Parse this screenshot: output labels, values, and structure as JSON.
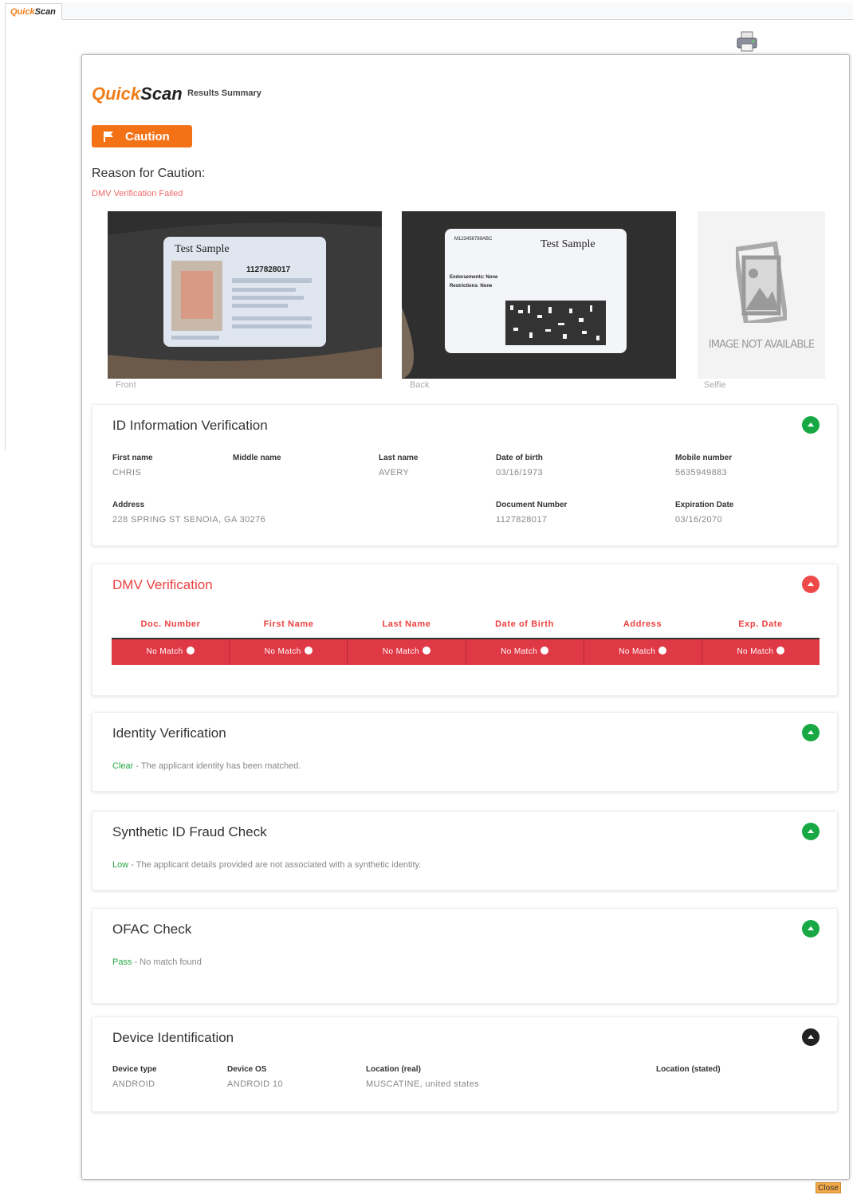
{
  "tab": {
    "brand_quick": "Quick",
    "brand_scan": "Scan"
  },
  "header": {
    "brand_quick": "Quick",
    "brand_scan": "Scan",
    "subtitle": "Results Summary"
  },
  "status": {
    "label": "Caution",
    "color": "#f47216"
  },
  "reason": {
    "title": "Reason for Caution:",
    "text": "DMV Verification Failed"
  },
  "images": {
    "front": {
      "caption": "Front",
      "card_title": "Test Sample",
      "dln": "1127828017"
    },
    "back": {
      "caption": "Back",
      "card_title": "Test Sample",
      "code": "M123456789ABC",
      "endorsements": "Endorsements: None",
      "restrictions": "Restrictions: None"
    },
    "selfie": {
      "caption": "Selfie",
      "placeholder": "IMAGE NOT AVAILABLE"
    }
  },
  "id_verification": {
    "title": "ID Information Verification",
    "fields": {
      "first_name": {
        "label": "First name",
        "value": "CHRIS"
      },
      "middle_name": {
        "label": "Middle name",
        "value": ""
      },
      "last_name": {
        "label": "Last name",
        "value": "AVERY"
      },
      "dob": {
        "label": "Date of birth",
        "value": "03/16/1973"
      },
      "mobile": {
        "label": "Mobile number",
        "value": "5635949883"
      },
      "address": {
        "label": "Address",
        "value": "228 SPRING ST SENOIA, GA 30276"
      },
      "doc_number": {
        "label": "Document Number",
        "value": "1127828017"
      },
      "expiration": {
        "label": "Expiration Date",
        "value": "03/16/2070"
      }
    }
  },
  "dmv": {
    "title": "DMV Verification",
    "headers": [
      "Doc. Number",
      "First Name",
      "Last Name",
      "Date of Birth",
      "Address",
      "Exp. Date"
    ],
    "results": [
      "No Match",
      "No Match",
      "No Match",
      "No Match",
      "No Match",
      "No Match"
    ]
  },
  "identity": {
    "title": "Identity Verification",
    "status": "Clear",
    "text": " - The applicant identity has been matched."
  },
  "synthetic": {
    "title": "Synthetic ID Fraud Check",
    "status": "Low",
    "text": " - The applicant details provided are not associated with a synthetic identity."
  },
  "ofac": {
    "title": "OFAC Check",
    "status": "Pass",
    "text": " - No match found"
  },
  "device": {
    "title": "Device Identification",
    "fields": {
      "type": {
        "label": "Device type",
        "value": "ANDROID"
      },
      "os": {
        "label": "Device OS",
        "value": "ANDROID 10"
      },
      "loc_real": {
        "label": "Location (real)",
        "value": "MUSCATINE, united states"
      },
      "loc_stated": {
        "label": "Location (stated)",
        "value": ""
      }
    }
  },
  "footer": {
    "close_label": "Close"
  }
}
